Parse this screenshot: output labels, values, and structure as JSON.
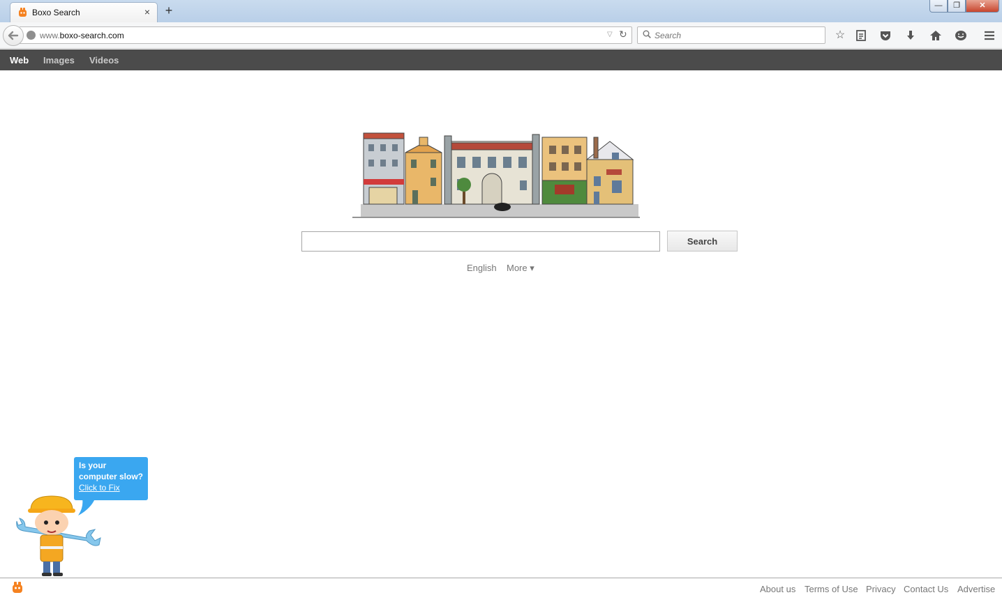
{
  "browser": {
    "tab_title": "Boxo Search",
    "tab_close": "×",
    "new_tab": "+",
    "url_prefix": "www.",
    "url_domain": "boxo-search.com",
    "search_placeholder": "Search",
    "window_controls": {
      "minimize": "—",
      "maximize": "❐",
      "close": "✕"
    }
  },
  "toolbar_icons": [
    "star-icon",
    "reading-list-icon",
    "pocket-icon",
    "download-icon",
    "home-icon",
    "chat-icon",
    "menu-icon"
  ],
  "sitenav": {
    "web": "Web",
    "images": "Images",
    "videos": "Videos"
  },
  "search": {
    "button": "Search",
    "value": ""
  },
  "language": {
    "current": "English",
    "more": "More ▾"
  },
  "promo": {
    "line1": "Is your",
    "line2": "computer slow?",
    "link": "Click to Fix"
  },
  "footer": {
    "about": "About us",
    "terms": "Terms of Use",
    "privacy": "Privacy",
    "contact": "Contact Us",
    "advertise": "Advertise"
  },
  "colors": {
    "accent_orange": "#f58220",
    "nav_bg": "#4b4b4b",
    "promo_blue": "#3aa7f0"
  }
}
